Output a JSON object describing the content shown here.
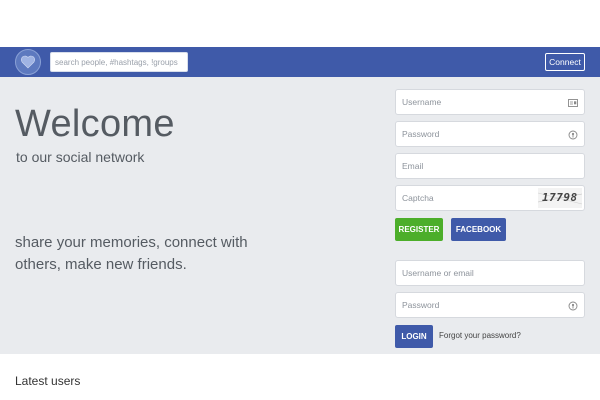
{
  "header": {
    "search_placeholder": "search people, #hashtags, !groups",
    "connect_label": "Connect",
    "logo_icon": "heart-logo-icon",
    "bar_color": "#3f5aa9"
  },
  "hero": {
    "title": "Welcome",
    "subtitle": "to our social network",
    "tagline": "share your memories, connect with others, make new friends.",
    "background": "#e9ebee"
  },
  "register_form": {
    "username_placeholder": "Username",
    "username_icon": "id-card-icon",
    "password_placeholder": "Password",
    "password_icon": "key-icon",
    "email_placeholder": "Email",
    "captcha_placeholder": "Captcha",
    "captcha_text": "17798",
    "register_label": "REGISTER",
    "facebook_label": "FACEBOOK",
    "register_color": "#4cae2a",
    "facebook_color": "#3f5aa9"
  },
  "login_form": {
    "user_placeholder": "Username or email",
    "password_placeholder": "Password",
    "password_icon": "key-icon",
    "login_label": "LOGIN",
    "forgot_link": "Forgot your password?"
  },
  "latest": {
    "heading": "Latest users"
  }
}
